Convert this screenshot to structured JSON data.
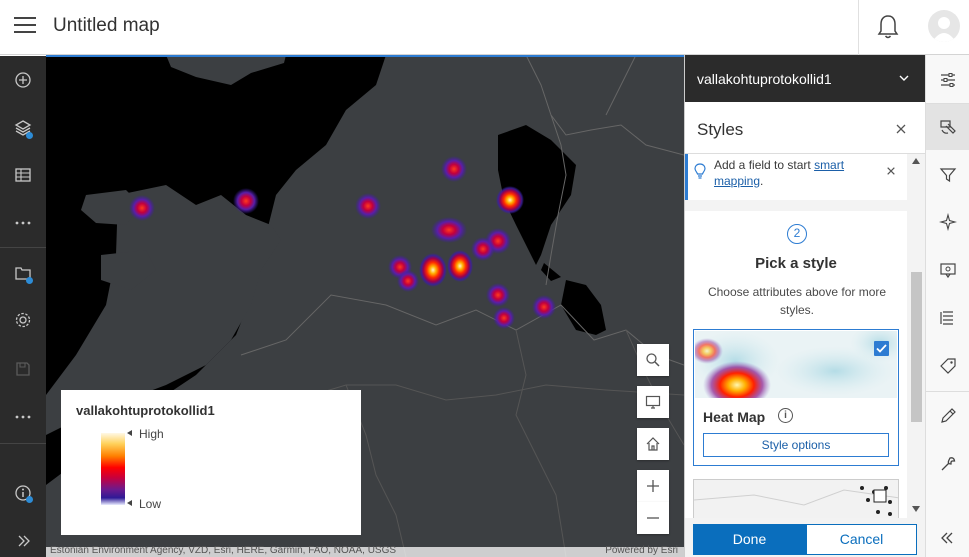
{
  "header": {
    "title": "Untitled map"
  },
  "left_toolbar": {
    "items": [
      "add-icon",
      "layers-icon",
      "table-icon",
      "more-icon",
      "folder-icon",
      "gear-icon",
      "save-icon",
      "more-icon",
      "info-icon",
      "expand-icon"
    ]
  },
  "map": {
    "attribution": "Estonian Environment Agency, VZD, Esri, HERE, Garmin, FAO, NOAA, USGS",
    "powered_by": "Powered by Esri"
  },
  "legend": {
    "title": "vallakohtuprotokollid1",
    "high_label": "High",
    "low_label": "Low"
  },
  "panel": {
    "layer_name": "vallakohtuprotokollid1",
    "styles_title": "Styles",
    "notice_prefix": "Add a field to start ",
    "notice_link": "smart mapping",
    "notice_suffix": ".",
    "step_number": "2",
    "pick_title": "Pick a style",
    "pick_desc": "Choose attributes above for more styles.",
    "style_name": "Heat Map",
    "style_selected": true,
    "style_options_label": "Style options",
    "done_label": "Done",
    "cancel_label": "Cancel"
  },
  "right_toolbar": {
    "items": [
      "properties-icon",
      "styles-icon",
      "filter-icon",
      "effects-icon",
      "popups-icon",
      "labels-icon",
      "tags-icon",
      "sketch-icon",
      "wrench-icon",
      "collapse-icon"
    ],
    "active": "styles-icon"
  },
  "colors": {
    "accent": "#2d7cd2",
    "done_button": "#0a6ebd",
    "map_land": "#3c3f42",
    "map_water": "#000000",
    "left_bar": "#2b2b2b"
  }
}
